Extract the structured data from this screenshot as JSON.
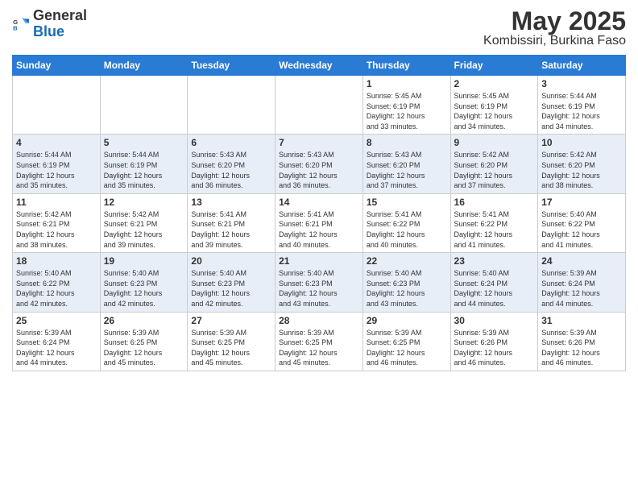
{
  "header": {
    "logo_general": "General",
    "logo_blue": "Blue",
    "title": "May 2025",
    "subtitle": "Kombissiri, Burkina Faso"
  },
  "days_of_week": [
    "Sunday",
    "Monday",
    "Tuesday",
    "Wednesday",
    "Thursday",
    "Friday",
    "Saturday"
  ],
  "weeks": [
    [
      {
        "num": "",
        "info": ""
      },
      {
        "num": "",
        "info": ""
      },
      {
        "num": "",
        "info": ""
      },
      {
        "num": "",
        "info": ""
      },
      {
        "num": "1",
        "info": "Sunrise: 5:45 AM\nSunset: 6:19 PM\nDaylight: 12 hours\nand 33 minutes."
      },
      {
        "num": "2",
        "info": "Sunrise: 5:45 AM\nSunset: 6:19 PM\nDaylight: 12 hours\nand 34 minutes."
      },
      {
        "num": "3",
        "info": "Sunrise: 5:44 AM\nSunset: 6:19 PM\nDaylight: 12 hours\nand 34 minutes."
      }
    ],
    [
      {
        "num": "4",
        "info": "Sunrise: 5:44 AM\nSunset: 6:19 PM\nDaylight: 12 hours\nand 35 minutes."
      },
      {
        "num": "5",
        "info": "Sunrise: 5:44 AM\nSunset: 6:19 PM\nDaylight: 12 hours\nand 35 minutes."
      },
      {
        "num": "6",
        "info": "Sunrise: 5:43 AM\nSunset: 6:20 PM\nDaylight: 12 hours\nand 36 minutes."
      },
      {
        "num": "7",
        "info": "Sunrise: 5:43 AM\nSunset: 6:20 PM\nDaylight: 12 hours\nand 36 minutes."
      },
      {
        "num": "8",
        "info": "Sunrise: 5:43 AM\nSunset: 6:20 PM\nDaylight: 12 hours\nand 37 minutes."
      },
      {
        "num": "9",
        "info": "Sunrise: 5:42 AM\nSunset: 6:20 PM\nDaylight: 12 hours\nand 37 minutes."
      },
      {
        "num": "10",
        "info": "Sunrise: 5:42 AM\nSunset: 6:20 PM\nDaylight: 12 hours\nand 38 minutes."
      }
    ],
    [
      {
        "num": "11",
        "info": "Sunrise: 5:42 AM\nSunset: 6:21 PM\nDaylight: 12 hours\nand 38 minutes."
      },
      {
        "num": "12",
        "info": "Sunrise: 5:42 AM\nSunset: 6:21 PM\nDaylight: 12 hours\nand 39 minutes."
      },
      {
        "num": "13",
        "info": "Sunrise: 5:41 AM\nSunset: 6:21 PM\nDaylight: 12 hours\nand 39 minutes."
      },
      {
        "num": "14",
        "info": "Sunrise: 5:41 AM\nSunset: 6:21 PM\nDaylight: 12 hours\nand 40 minutes."
      },
      {
        "num": "15",
        "info": "Sunrise: 5:41 AM\nSunset: 6:22 PM\nDaylight: 12 hours\nand 40 minutes."
      },
      {
        "num": "16",
        "info": "Sunrise: 5:41 AM\nSunset: 6:22 PM\nDaylight: 12 hours\nand 41 minutes."
      },
      {
        "num": "17",
        "info": "Sunrise: 5:40 AM\nSunset: 6:22 PM\nDaylight: 12 hours\nand 41 minutes."
      }
    ],
    [
      {
        "num": "18",
        "info": "Sunrise: 5:40 AM\nSunset: 6:22 PM\nDaylight: 12 hours\nand 42 minutes."
      },
      {
        "num": "19",
        "info": "Sunrise: 5:40 AM\nSunset: 6:23 PM\nDaylight: 12 hours\nand 42 minutes."
      },
      {
        "num": "20",
        "info": "Sunrise: 5:40 AM\nSunset: 6:23 PM\nDaylight: 12 hours\nand 42 minutes."
      },
      {
        "num": "21",
        "info": "Sunrise: 5:40 AM\nSunset: 6:23 PM\nDaylight: 12 hours\nand 43 minutes."
      },
      {
        "num": "22",
        "info": "Sunrise: 5:40 AM\nSunset: 6:23 PM\nDaylight: 12 hours\nand 43 minutes."
      },
      {
        "num": "23",
        "info": "Sunrise: 5:40 AM\nSunset: 6:24 PM\nDaylight: 12 hours\nand 44 minutes."
      },
      {
        "num": "24",
        "info": "Sunrise: 5:39 AM\nSunset: 6:24 PM\nDaylight: 12 hours\nand 44 minutes."
      }
    ],
    [
      {
        "num": "25",
        "info": "Sunrise: 5:39 AM\nSunset: 6:24 PM\nDaylight: 12 hours\nand 44 minutes."
      },
      {
        "num": "26",
        "info": "Sunrise: 5:39 AM\nSunset: 6:25 PM\nDaylight: 12 hours\nand 45 minutes."
      },
      {
        "num": "27",
        "info": "Sunrise: 5:39 AM\nSunset: 6:25 PM\nDaylight: 12 hours\nand 45 minutes."
      },
      {
        "num": "28",
        "info": "Sunrise: 5:39 AM\nSunset: 6:25 PM\nDaylight: 12 hours\nand 45 minutes."
      },
      {
        "num": "29",
        "info": "Sunrise: 5:39 AM\nSunset: 6:25 PM\nDaylight: 12 hours\nand 46 minutes."
      },
      {
        "num": "30",
        "info": "Sunrise: 5:39 AM\nSunset: 6:26 PM\nDaylight: 12 hours\nand 46 minutes."
      },
      {
        "num": "31",
        "info": "Sunrise: 5:39 AM\nSunset: 6:26 PM\nDaylight: 12 hours\nand 46 minutes."
      }
    ]
  ]
}
